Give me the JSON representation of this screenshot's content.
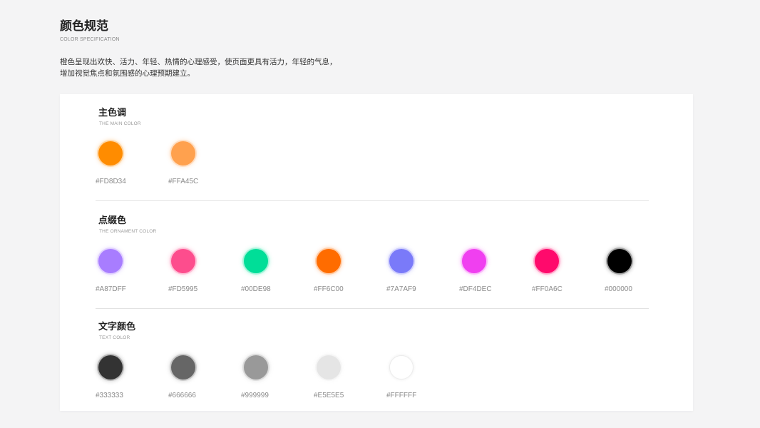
{
  "header": {
    "title": "颜色规范",
    "subtitle": "COLOR SPECIFICATION",
    "description_lines": [
      "橙色呈现出欢快、活力、年轻、热情的心理感受，使页面更具有活力，年轻的气息，",
      "增加视觉焦点和氛围感的心理预期建立。"
    ]
  },
  "sections": [
    {
      "title": "主色调",
      "subtitle": "THE MAIN COLOR",
      "swatches": [
        {
          "code": "#FD8D34",
          "color": "#FF8C00"
        },
        {
          "code": "#FFA45C",
          "color": "#FFA14E"
        }
      ]
    },
    {
      "title": "点缀色",
      "subtitle": "THE ORNAMENT COLOR",
      "swatches": [
        {
          "code": "#A87DFF",
          "color": "#A87DFF"
        },
        {
          "code": "#FD5995",
          "color": "#FD4D8D"
        },
        {
          "code": "#00DE98",
          "color": "#00DE98"
        },
        {
          "code": "#FF6C00",
          "color": "#FF6C00"
        },
        {
          "code": "#7A7AF9",
          "color": "#7A7AF9"
        },
        {
          "code": "#DF4DEC",
          "color": "#F03FF0"
        },
        {
          "code": "#FF0A6C",
          "color": "#FF0A6C"
        },
        {
          "code": "#000000",
          "color": "#000000"
        }
      ]
    },
    {
      "title": "文字颜色",
      "subtitle": "TEXT COLOR",
      "swatches": [
        {
          "code": "#333333",
          "color": "#333333"
        },
        {
          "code": "#666666",
          "color": "#666666"
        },
        {
          "code": "#999999",
          "color": "#999999"
        },
        {
          "code": "#E5E5E5",
          "color": "#E5E5E5"
        },
        {
          "code": "#FFFFFF",
          "color": "#FFFFFF"
        }
      ]
    }
  ]
}
